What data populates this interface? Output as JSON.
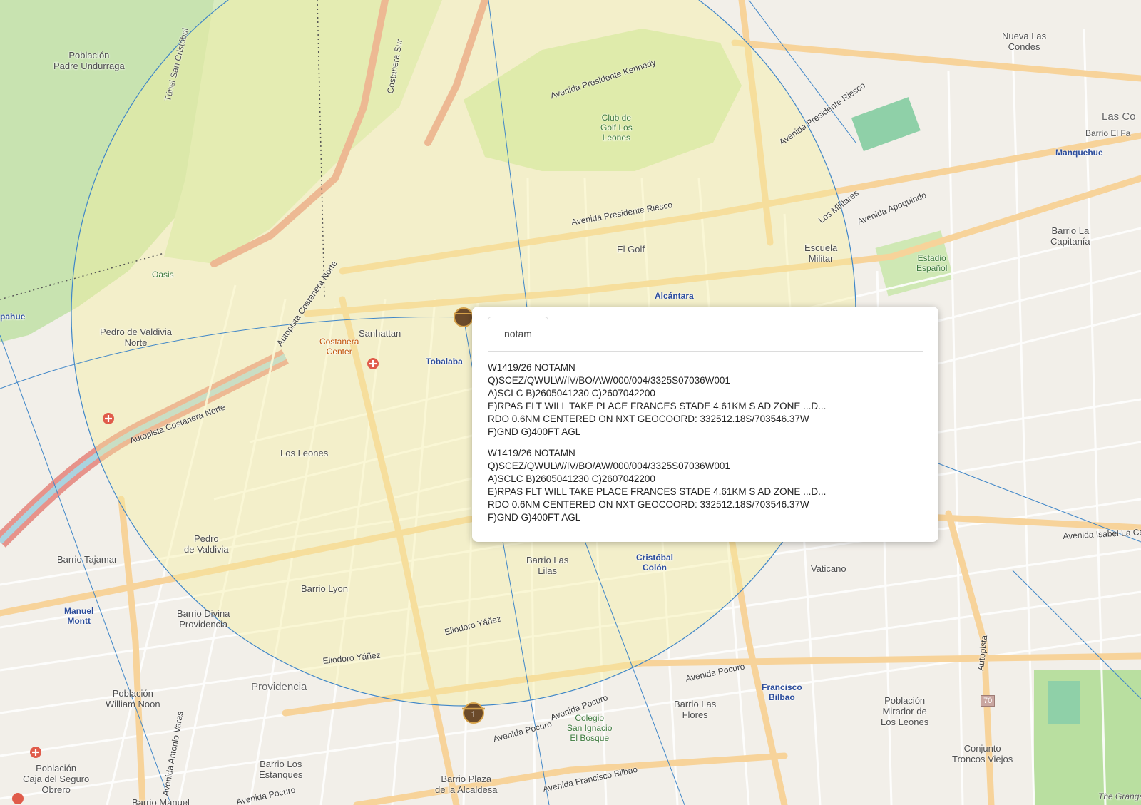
{
  "popup": {
    "tabs": [
      {
        "label": "notam"
      }
    ],
    "notams": [
      {
        "lines": [
          "W1419/26 NOTAMN",
          "Q)SCEZ/QWULW/IV/BO/AW/000/004/3325S07036W001",
          "A)SCLC B)2605041230 C)2607042200",
          "E)RPAS FLT WILL TAKE PLACE FRANCES STADE 4.61KM S AD ZONE ...D...",
          "RDO 0.6NM CENTERED ON NXT GEOCOORD: 332512.18S/703546.37W",
          "F)GND G)400FT AGL"
        ]
      },
      {
        "lines": [
          "W1419/26 NOTAMN",
          "Q)SCEZ/QWULW/IV/BO/AW/000/004/3325S07036W001",
          "A)SCLC B)2605041230 C)2607042200",
          "E)RPAS FLT WILL TAKE PLACE FRANCES STADE 4.61KM S AD ZONE ...D...",
          "RDO 0.6NM CENTERED ON NXT GEOCOORD: 332512.18S/703546.37W",
          "F)GND G)400FT AGL"
        ]
      }
    ]
  },
  "map": {
    "colors": {
      "circle_fill": "#f5eea0",
      "circle_stroke": "#3f86c8",
      "major_road": "#f7d39a",
      "motorway": "#e7938b",
      "park": "#cfe8b4",
      "river": "#aad3df"
    },
    "markers": [
      {
        "name": "notam-marker-top",
        "label": ""
      },
      {
        "name": "notam-marker-bottom",
        "label": "1"
      }
    ],
    "labels": {
      "poblacion_padre": "Población\nPadre Undurraga",
      "tunel": "Túnel San Cristóbal",
      "costanera_sur": "Costanera Sur",
      "av_kennedy": "Avenida Presidente Kennedy",
      "club_golf": "Club de\nGolf Los\nLeones",
      "av_riesco": "Avenida Presidente Riesco",
      "av_riesco2": "Avenida Presidente Riesco",
      "los_militares": "Los Militares",
      "av_apoquindo": "Avenida Apoquindo",
      "el_golf": "El Golf",
      "escuela_militar": "Escuela\nMilitar",
      "alcantara": "Alcántara",
      "estadio_espanol": "Estadio\nEspañol",
      "barrio_la_capitania": "Barrio La\nCapitanía",
      "manquehue": "Manquehue",
      "nueva_las_condes": "Nueva Las\nCondes",
      "las_condes": "Las Co",
      "barrio_el_fa": "Barrio El Fa",
      "oasis": "Oasis",
      "pedro_valdivia_norte": "Pedro de Valdivia\nNorte",
      "sanhattan": "Sanhattan",
      "costanera_center": "Costanera\nCenter",
      "tobalaba": "Tobalaba",
      "autopista_costanera_norte": "Autopista Costanera Norte",
      "autopista_costanera_norte2": "Autopista Costanera Norte",
      "los_leones": "Los Leones",
      "pedro_valdivia": "Pedro\nde Valdivia",
      "barrio_lyon": "Barrio Lyon",
      "barrio_tajamar": "Barrio Tajamar",
      "manuel_montt": "Manuel\nMontt",
      "barrio_divina": "Barrio Divina\nProvidencia",
      "providencia": "Providencia",
      "poblacion_william": "Población\nWilliam Noon",
      "eliodoro_yanez": "Eliodoro Yáñez",
      "eliodoro_yanez2": "Eliodoro Yáñez",
      "barrio_las_lilas": "Barrio Las\nLilas",
      "cristobal_colon": "Cristóbal\nColón",
      "vaticano": "Vaticano",
      "av_isabel": "Avenida Isabel La Ca",
      "av_pocuro": "Avenida Pocuro",
      "av_pocuro2": "Avenida Pocuro",
      "av_pocuro3": "Avenida Pocuro",
      "av_pocuro4": "Avenida Pocuro",
      "colegio": "Colegio\nSan Ignacio\nEl Bosque",
      "barrio_las_flores": "Barrio Las\nFlores",
      "francisco_bilbao": "Francisco\nBilbao",
      "poblacion_mirador": "Población\nMirador de\nLos Leones",
      "conjunto": "Conjunto\nTroncos Viejos",
      "autopista": "Autopista",
      "av_francisco_bilbao": "Avenida Francisco Bilbao",
      "barrio_plaza": "Barrio Plaza\nde la Alcaldesa",
      "barrio_los_estanques": "Barrio Los\nEstanques",
      "poblacion_caja": "Población\nCaja del Seguro\nObrero",
      "barrio_manuel": "Barrio Manuel",
      "av_antonio_varas": "Avenida Antonio Varas",
      "the_grange": "The Grange",
      "pahue": "pahue",
      "shield_70": "70"
    }
  }
}
